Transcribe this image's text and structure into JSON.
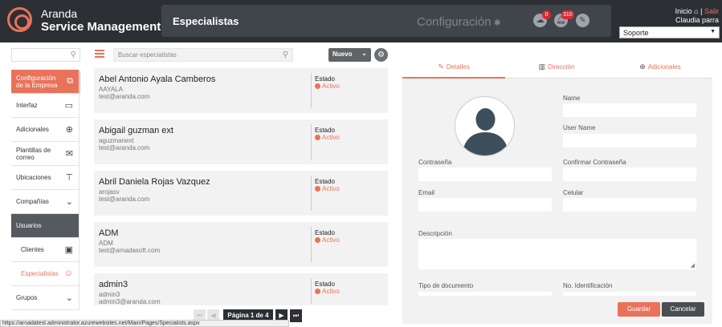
{
  "header": {
    "brand_line1": "Aranda",
    "brand_line2": "Service Management",
    "page_title": "Especialistas",
    "config_label": "Configuración",
    "config_icon": "gear-icon",
    "badges": {
      "messages": "0",
      "notifications": "310"
    },
    "links": {
      "home": "Inicio",
      "separator": "|",
      "logout": "Salir"
    },
    "user_name": "Claudia parra",
    "role": "Soporte"
  },
  "sidebar": {
    "items": [
      {
        "label": "Configuración de la Empresa",
        "icon": "building-icon"
      },
      {
        "label": "Interfaz",
        "icon": "monitor-icon"
      },
      {
        "label": "Adicionales",
        "icon": "plus-circle-icon"
      },
      {
        "label": "Plantillas de correo",
        "icon": "envelope-icon"
      },
      {
        "label": "Ubicaciones",
        "icon": "signpost-icon"
      },
      {
        "label": "Compañías",
        "icon": "chevron-down-icon"
      },
      {
        "label": "Usuarios"
      },
      {
        "label": "Clientes",
        "icon": "contact-card-icon"
      },
      {
        "label": "Especialistas",
        "icon": "specialist-icon"
      },
      {
        "label": "Grupos",
        "icon": "chevron-down-icon"
      }
    ]
  },
  "toolbar": {
    "search_placeholder": "Buscar especialistas",
    "new_label": "Nuevo"
  },
  "specialists": [
    {
      "name": "Abel Antonio Ayala Camberos",
      "username": "AAYALA",
      "email": "test@aranda.com",
      "estado_label": "Estado",
      "status": "Activo"
    },
    {
      "name": "Abigail guzman ext",
      "username": "aguzmanext",
      "email": "test@aranda.com",
      "estado_label": "Estado",
      "status": "Activo"
    },
    {
      "name": "Abril Daniela Rojas Vazquez",
      "username": "arojasv",
      "email": "test@aranda.com",
      "estado_label": "Estado",
      "status": "Activo"
    },
    {
      "name": "ADM",
      "username": "ADM",
      "email": "test@arnadasoft.com",
      "estado_label": "Estado",
      "status": "Activo"
    },
    {
      "name": "admin3",
      "username": "admin3",
      "email": "admin3@aranda.com",
      "estado_label": "Estado",
      "status": "Activo"
    }
  ],
  "pagination": {
    "label": "Página 1 de 4"
  },
  "statusbar": {
    "url": "https://arnadatest.administrator.azurewebsites.net/Main/Pages/Specialists.aspx"
  },
  "form": {
    "tabs": [
      {
        "label": "Detalles",
        "icon": "edit-icon"
      },
      {
        "label": "Dirección",
        "icon": "building-icon"
      },
      {
        "label": "Adicionales",
        "icon": "plus-circle-icon"
      }
    ],
    "labels": {
      "name": "Name",
      "user_name": "User Name",
      "password": "Contraseña",
      "confirm_password": "Confirmar Contraseña",
      "email": "Email",
      "cell": "Celular",
      "description": "Descripción",
      "doc_type": "Tipo de documento",
      "id_number": "No. Identificación"
    },
    "save_label": "Guardar",
    "cancel_label": "Cancelar"
  },
  "colors": {
    "accent": "#e8735a",
    "header_bg": "#2c2f33",
    "badge": "#d9282f"
  }
}
